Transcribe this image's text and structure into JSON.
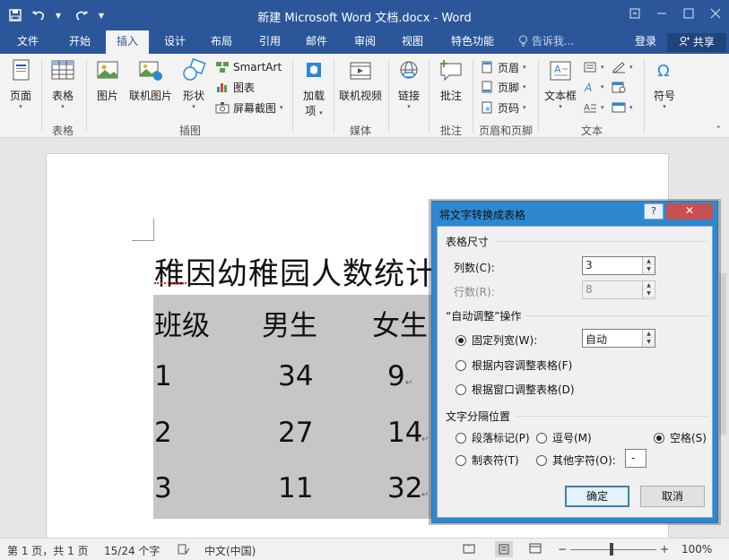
{
  "window": {
    "title": "新建 Microsoft Word 文档.docx - Word"
  },
  "tabs": [
    "文件",
    "开始",
    "插入",
    "设计",
    "布局",
    "引用",
    "邮件",
    "审阅",
    "视图",
    "特色功能"
  ],
  "active_tab": "插入",
  "tell_me": "告诉我...",
  "login": "登录",
  "share": "共享",
  "ribbon": {
    "page": "页面",
    "table": "表格",
    "picture": "图片",
    "online_picture": "联机图片",
    "shapes": "形状",
    "smartart": "SmartArt",
    "chart": "图表",
    "screenshot": "屏幕截图",
    "addins_line1": "加载",
    "addins_line2": "项",
    "online_video": "联机视频",
    "link": "链接",
    "comment": "批注",
    "header": "页眉",
    "footer": "页脚",
    "page_number": "页码",
    "textbox": "文本框",
    "symbol": "符号",
    "groups": {
      "tables": "表格",
      "illustrations": "插图",
      "media": "媒体",
      "comments": "批注",
      "header_footer": "页眉和页脚",
      "text": "文本"
    }
  },
  "document": {
    "title": "稚因幼稚园人数统计",
    "rows": [
      [
        "班级",
        "男生",
        "女生"
      ],
      [
        "1",
        "34",
        "9"
      ],
      [
        "2",
        "27",
        "14"
      ],
      [
        "3",
        "11",
        "32"
      ]
    ],
    "para_mark": "↵"
  },
  "dialog": {
    "title": "将文字转换成表格",
    "help": "?",
    "close": "✕",
    "section_size": "表格尺寸",
    "columns_label": "列数(C):",
    "columns_value": "3",
    "rows_label": "行数(R):",
    "rows_value": "8",
    "section_autofit": "“自动调整”操作",
    "fixed_width": "固定列宽(W):",
    "fixed_width_value": "自动",
    "autofit_content": "根据内容调整表格(F)",
    "autofit_window": "根据窗口调整表格(D)",
    "section_separator": "文字分隔位置",
    "sep_paragraph": "段落标记(P)",
    "sep_comma": "逗号(M)",
    "sep_space": "空格(S)",
    "sep_tab": "制表符(T)",
    "sep_other": "其他字符(O):",
    "sep_other_value": "-",
    "ok": "确定",
    "cancel": "取消"
  },
  "status": {
    "page": "第 1 页，共 1 页",
    "words": "15/24 个字",
    "language": "中文(中国)",
    "zoom": "100%"
  },
  "colors": {
    "brand": "#2b579a",
    "selection": "#c6c6c6",
    "dialog_frame": "#2d88d0",
    "close_button": "#c75050"
  }
}
